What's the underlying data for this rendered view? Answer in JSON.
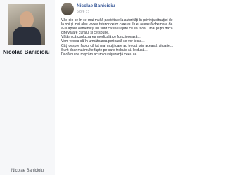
{
  "profile": {
    "name": "Nicolae Banicioiu",
    "bottom_caption": "Nicolae Banicioiu"
  },
  "post": {
    "author": "Nicolae Banicioiu",
    "time": "6 ore",
    "icons": [
      "globe-icon",
      "more-icon"
    ],
    "paragraphs": [
      "Văd din ce în ce mai multă pasivitate la autorități în privința situației de la noi și mai ales vocea tuturor celor care au în ei această chemare de a-și apăra oamenii și nu sunt ca să îi ajute ce să facă... mai puțin dacă cineva are curajul și ce spune.",
      "Vătăm că conlucrarea medicală ce funcționează...",
      "Vom vedea că în următoarea perioadă se vor testa...",
      "Câți despre faptul că tot mai mulți care au trecut prin această situație...",
      "Sunt doar mai multe fapte pe care trebuie să le ducă...",
      "Dacă nu ne mișcăm acum cu siguranță ceea ce..."
    ]
  }
}
